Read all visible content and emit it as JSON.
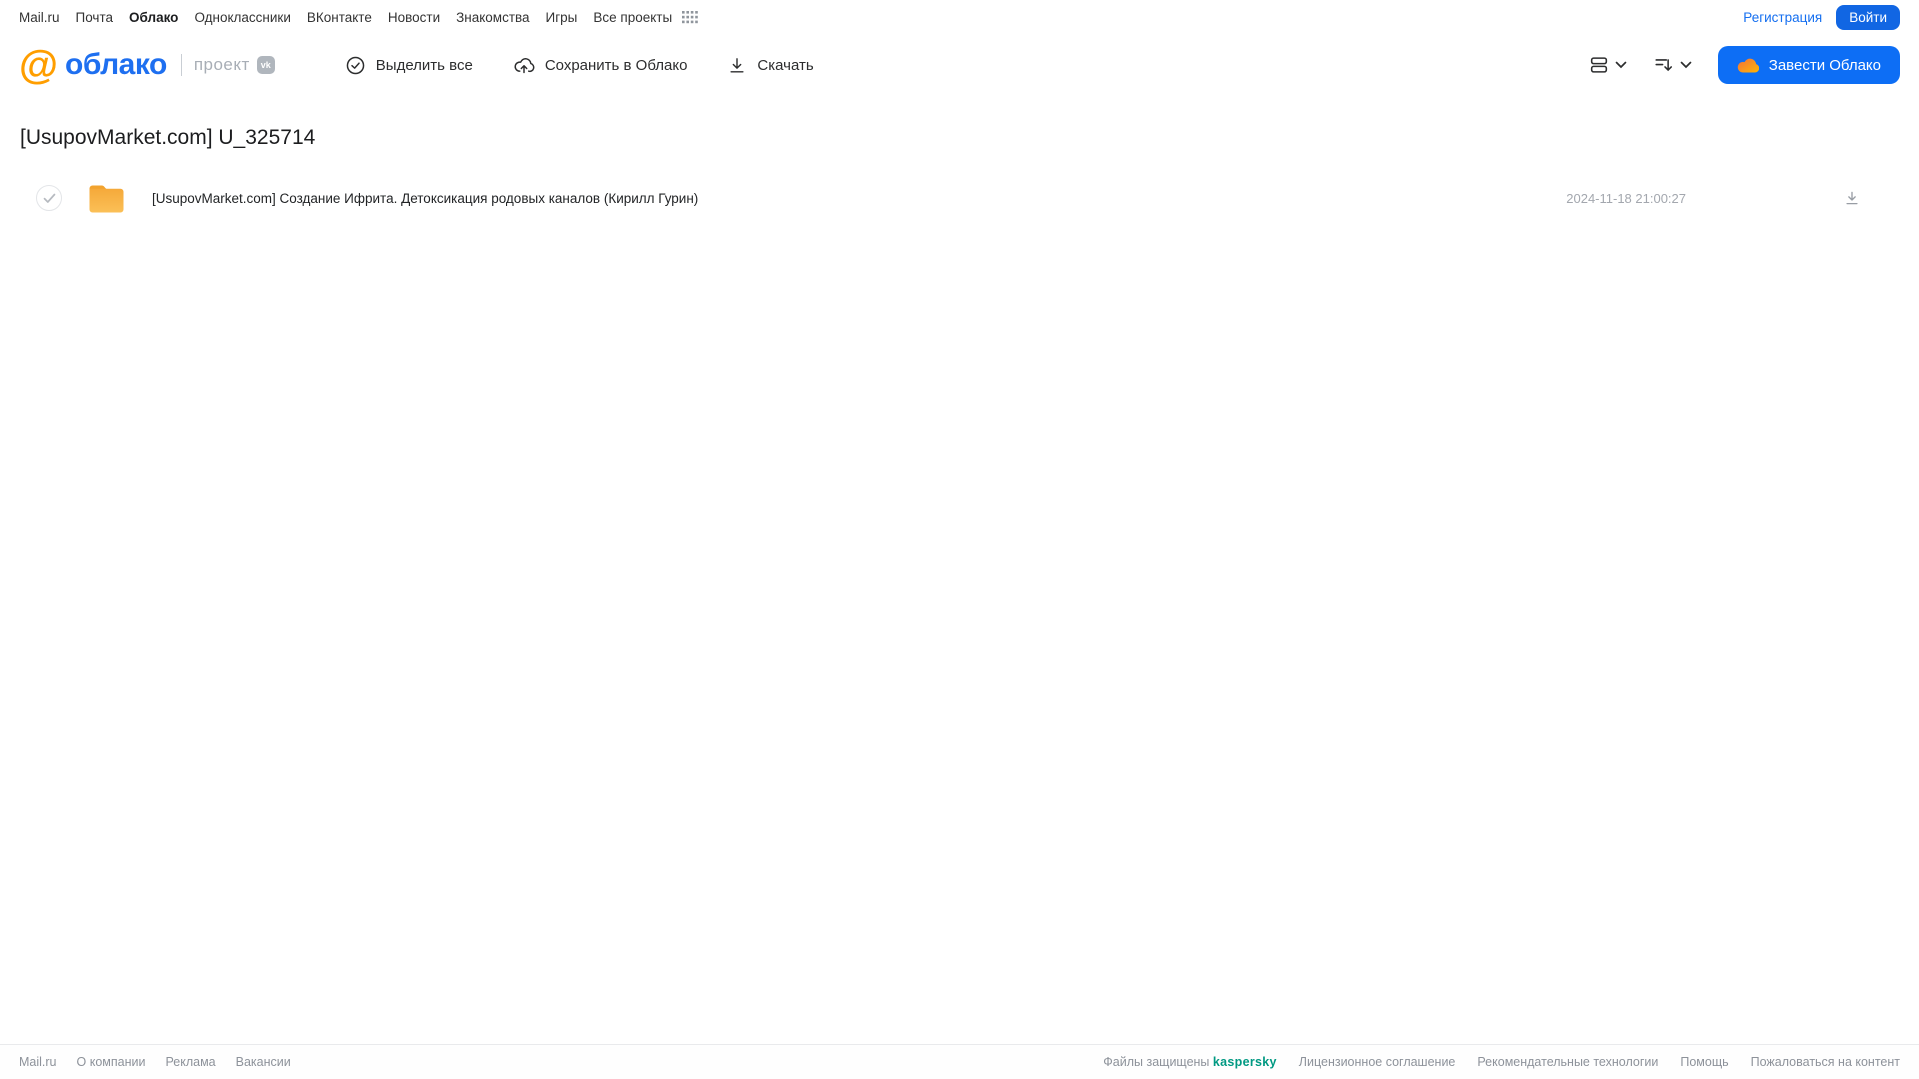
{
  "portal_nav": {
    "links": [
      {
        "label": "Mail.ru"
      },
      {
        "label": "Почта"
      },
      {
        "label": "Облако"
      },
      {
        "label": "Одноклассники"
      },
      {
        "label": "ВКонтакте"
      },
      {
        "label": "Новости"
      },
      {
        "label": "Знакомства"
      },
      {
        "label": "Игры"
      },
      {
        "label": "Все проекты"
      }
    ],
    "register_label": "Регистрация",
    "login_label": "Войти"
  },
  "header": {
    "logo_at": "@",
    "logo_text": "облако",
    "project_label": "проект",
    "vk_badge_label": "vk",
    "actions": [
      {
        "label": "Выделить все",
        "icon": "check-circle-icon"
      },
      {
        "label": "Сохранить в Облако",
        "icon": "cloud-upload-icon"
      },
      {
        "label": "Скачать",
        "icon": "download-icon"
      }
    ],
    "create_cloud_label": "Завести Облако"
  },
  "main": {
    "title": "[UsupovMarket.com] U_325714",
    "files": [
      {
        "name": "[UsupovMarket.com] Создание Ифрита. Детоксикация родовых каналов (Кирилл Гурин)",
        "date": "2024-11-18 21:00:27",
        "type": "folder"
      }
    ]
  },
  "footer": {
    "left_links": [
      {
        "label": "Mail.ru"
      },
      {
        "label": "О компании"
      },
      {
        "label": "Реклама"
      },
      {
        "label": "Вакансии"
      }
    ],
    "protected_label": "Файлы защищены",
    "kaspersky_label": "kaspersky",
    "right_links": [
      {
        "label": "Лицензионное соглашение"
      },
      {
        "label": "Рекомендательные технологии"
      },
      {
        "label": "Помощь"
      },
      {
        "label": "Пожаловаться на контент"
      }
    ]
  },
  "colors": {
    "accent_blue": "#0d6ef5",
    "logo_orange": "#ff9e00",
    "logo_blue": "#1e6ff0",
    "folder_yellow": "#f9b648",
    "kaspersky_teal": "#009982",
    "muted_gray": "#a3a7ae"
  }
}
